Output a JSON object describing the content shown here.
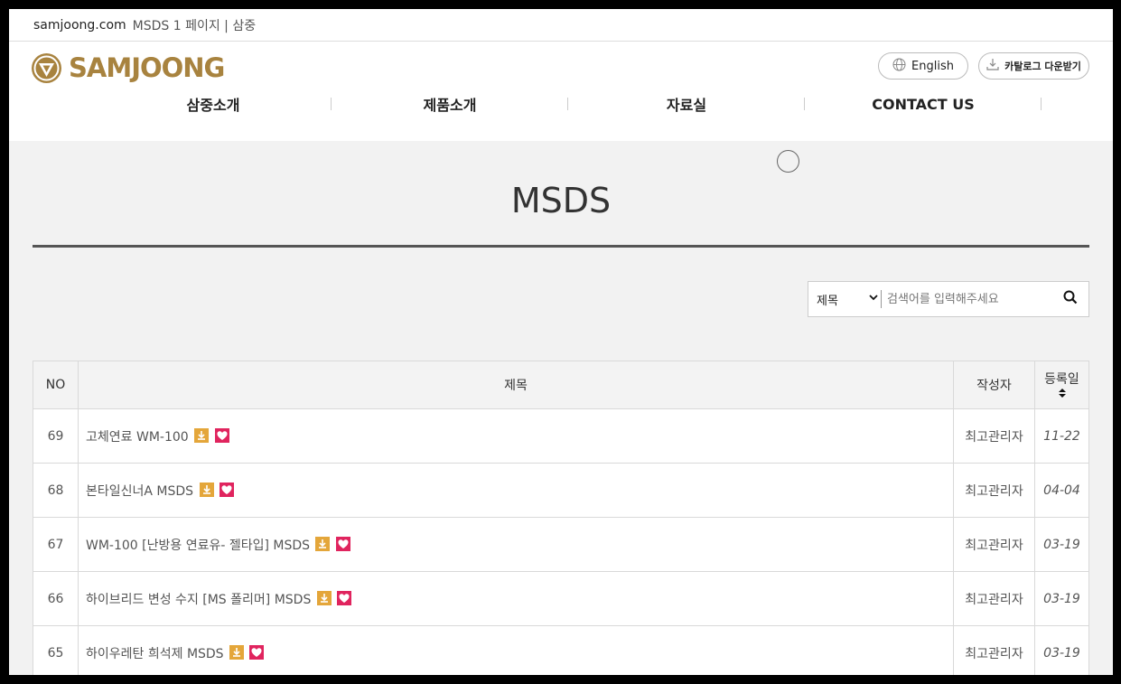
{
  "browser": {
    "domain": "samjoong.com",
    "title": "MSDS 1 페이지 | 삼중"
  },
  "header": {
    "logo_text": "SAMJOONG",
    "english_label": "English",
    "catalog_label": "카탈로그 다운받기",
    "nav": [
      {
        "label": "삼중소개"
      },
      {
        "label": "제품소개"
      },
      {
        "label": "자료실"
      },
      {
        "label": "CONTACT US"
      }
    ]
  },
  "page": {
    "title": "MSDS"
  },
  "search": {
    "selected_field": "제목",
    "placeholder": "검색어를 입력해주세요"
  },
  "table": {
    "headers": {
      "no": "NO",
      "title": "제목",
      "writer": "작성자",
      "date": "등록일"
    },
    "rows": [
      {
        "no": "69",
        "title": "고체연료 WM-100",
        "writer": "최고관리자",
        "date": "11-22"
      },
      {
        "no": "68",
        "title": "본타일신너A MSDS",
        "writer": "최고관리자",
        "date": "04-04"
      },
      {
        "no": "67",
        "title": "WM-100 [난방용 연료유- 젤타입] MSDS",
        "writer": "최고관리자",
        "date": "03-19"
      },
      {
        "no": "66",
        "title": "하이브리드 변성 수지 [MS 폴리머] MSDS",
        "writer": "최고관리자",
        "date": "03-19"
      },
      {
        "no": "65",
        "title": "하이우레탄 희석제 MSDS",
        "writer": "최고관리자",
        "date": "03-19"
      }
    ]
  },
  "colors": {
    "brand": "#a8833f",
    "download_badge": "#e4a63a",
    "heart_badge": "#e0245e"
  },
  "icons": [
    "globe-icon",
    "download-icon",
    "search-icon",
    "sort-icon",
    "file-download-icon",
    "heart-icon"
  ]
}
